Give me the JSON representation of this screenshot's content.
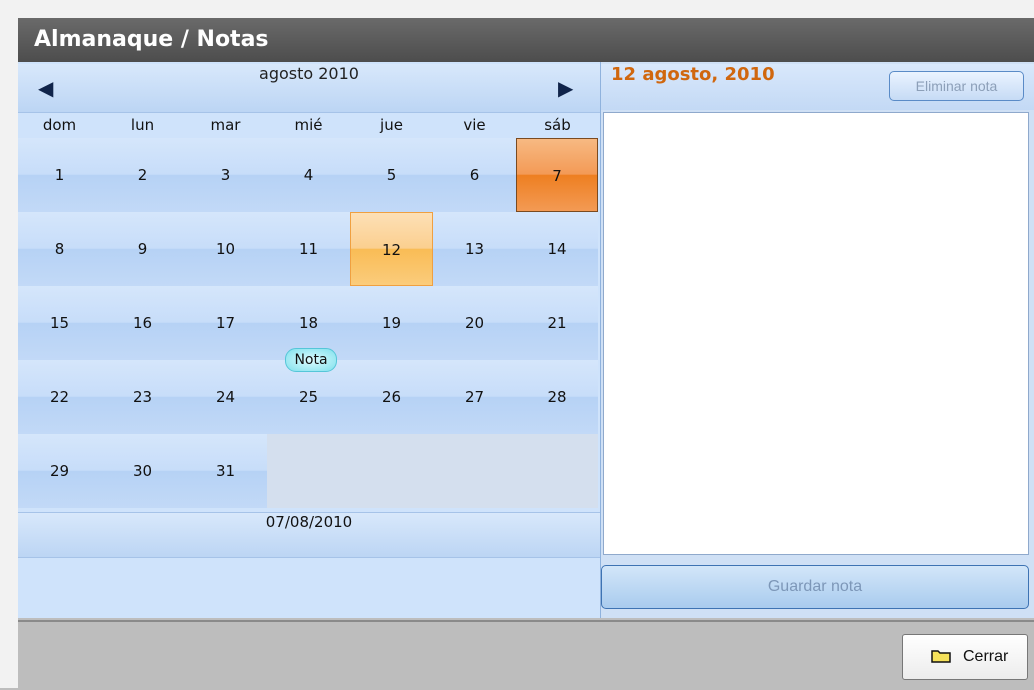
{
  "window": {
    "title": "Almanaque / Notas"
  },
  "calendar": {
    "month_label": "agosto 2010",
    "prev_icon": "triangle-left-icon",
    "next_icon": "triangle-right-icon",
    "weekdays": [
      "dom",
      "lun",
      "mar",
      "mié",
      "jue",
      "vie",
      "sáb"
    ],
    "weeks": [
      [
        "1",
        "2",
        "3",
        "4",
        "5",
        "6",
        "7"
      ],
      [
        "8",
        "9",
        "10",
        "11",
        "12",
        "13",
        "14"
      ],
      [
        "15",
        "16",
        "17",
        "18",
        "19",
        "20",
        "21"
      ],
      [
        "22",
        "23",
        "24",
        "25",
        "26",
        "27",
        "28"
      ],
      [
        "29",
        "30",
        "31",
        "",
        "",
        "",
        ""
      ]
    ],
    "selected_day": "7",
    "highlighted_day": "12",
    "note_badge": {
      "day": "18",
      "label": "Nota"
    },
    "footer_date": "07/08/2010"
  },
  "note": {
    "date_heading": "12 agosto, 2010",
    "delete_label": "Eliminar nota",
    "text": "",
    "save_label": "Guardar nota"
  },
  "footer": {
    "close_label": "Cerrar",
    "close_icon": "folder-icon"
  },
  "colors": {
    "selected": "#ee7f21",
    "highlighted": "#f9bc55",
    "date_heading": "#d0670e"
  }
}
